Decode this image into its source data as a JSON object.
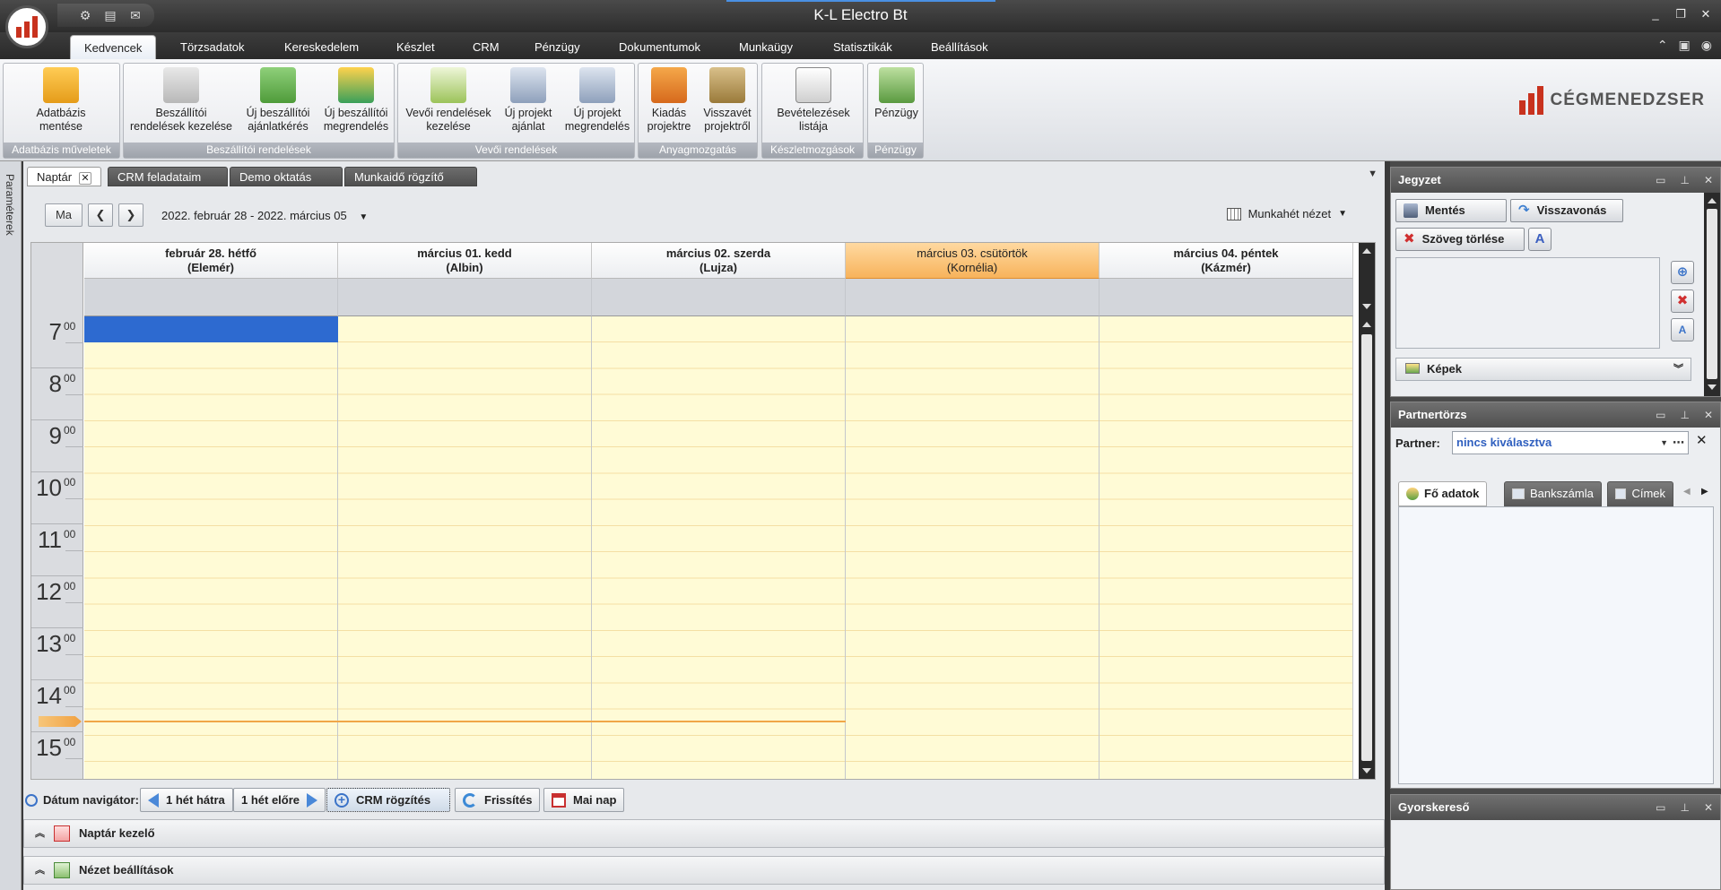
{
  "window": {
    "title": "K-L Electro Bt"
  },
  "quick_tools": [
    {
      "icon": "settings-icon"
    },
    {
      "icon": "clipboard-icon"
    },
    {
      "icon": "mail-icon"
    }
  ],
  "window_controls": [
    "_",
    "❐",
    "✕"
  ],
  "menu": {
    "tabs": [
      "Kedvencek",
      "Törzsadatok",
      "Kereskedelem",
      "Készlet",
      "CRM",
      "Pénzügy",
      "Dokumentumok",
      "Munkaügy",
      "Statisztikák",
      "Beállítások"
    ],
    "active": "Kedvencek",
    "right_icons": [
      "collapse-icon",
      "help-icon",
      "eye-icon"
    ]
  },
  "ribbon": {
    "groups": [
      {
        "label": "Adatbázis műveletek",
        "buttons": [
          {
            "line1": "Adatbázis",
            "line2": "mentése",
            "icon": "database-save-icon"
          }
        ]
      },
      {
        "label": "Beszállítói rendelések",
        "buttons": [
          {
            "line1": "Beszállítói",
            "line2": "rendelések kezelése",
            "icon": "supplier-orders-icon"
          },
          {
            "line1": "Új beszállítói",
            "line2": "ajánlatkérés",
            "icon": "supplier-quote-icon"
          },
          {
            "line1": "Új beszállítói",
            "line2": "megrendelés",
            "icon": "supplier-order-icon"
          }
        ]
      },
      {
        "label": "Vevői rendelések",
        "buttons": [
          {
            "line1": "Vevői rendelések",
            "line2": "kezelése",
            "icon": "customer-orders-icon"
          },
          {
            "line1": "Új projekt",
            "line2": "ajánlat",
            "icon": "project-offer-icon"
          },
          {
            "line1": "Új projekt",
            "line2": "megrendelés",
            "icon": "project-order-icon"
          }
        ]
      },
      {
        "label": "Anyagmozgatás",
        "buttons": [
          {
            "line1": "Kiadás",
            "line2": "projektre",
            "icon": "issue-box-icon"
          },
          {
            "line1": "Visszavét",
            "line2": "projektről",
            "icon": "return-box-icon"
          }
        ]
      },
      {
        "label": "Készletmozgások",
        "buttons": [
          {
            "line1": "Bevételezések",
            "line2": "listája",
            "icon": "receipts-list-icon"
          }
        ]
      },
      {
        "label": "Pénzügy",
        "buttons": [
          {
            "line1": "Pénzügy",
            "line2": "",
            "icon": "money-icon"
          }
        ]
      }
    ],
    "brand": "CÉGMENEDZSER"
  },
  "side_strip": {
    "label": "Paraméterek"
  },
  "doc_tabs": [
    {
      "label": "Naptár",
      "active": true
    },
    {
      "label": "CRM feladataim"
    },
    {
      "label": "Demo oktatás"
    },
    {
      "label": "Munkaidő rögzítő"
    }
  ],
  "calendar": {
    "today_button": "Ma",
    "prev_icon": "chevron-left-icon",
    "next_icon": "chevron-right-icon",
    "date_range": "2022. február 28 - 2022. március 05",
    "view": "Munkahét nézet",
    "days": [
      {
        "date": "február 28. hétfő",
        "name": "(Elemér)",
        "today": false
      },
      {
        "date": "március 01. kedd",
        "name": "(Albin)",
        "today": false
      },
      {
        "date": "március 02. szerda",
        "name": "(Lujza)",
        "today": false
      },
      {
        "date": "március 03. csütörtök",
        "name": "(Kornélia)",
        "today": true
      },
      {
        "date": "március 04. péntek",
        "name": "(Kázmér)",
        "today": false
      }
    ],
    "hours": [
      {
        "h": "7",
        "m": "00"
      },
      {
        "h": "8",
        "m": "00"
      },
      {
        "h": "9",
        "m": "00"
      },
      {
        "h": "10",
        "m": "00"
      },
      {
        "h": "11",
        "m": "00"
      },
      {
        "h": "12",
        "m": "00"
      },
      {
        "h": "13",
        "m": "00"
      },
      {
        "h": "14",
        "m": "00"
      },
      {
        "h": "15",
        "m": "00"
      }
    ],
    "colors": {
      "selection": "#2d6ad0",
      "today_header": "#f7b35b",
      "work_hours": "#fffbd6",
      "now_line": "#f0a648"
    }
  },
  "navigator": {
    "label": "Dátum navigátor:",
    "buttons": [
      "1 hét hátra",
      "1 hét előre",
      "CRM rögzítés",
      "Frissítés",
      "Mai nap"
    ]
  },
  "sections": [
    {
      "label": "Naptár kezelő"
    },
    {
      "label": "Nézet beállítások"
    }
  ],
  "panels": {
    "jegyzet": {
      "title": "Jegyzet",
      "save": "Mentés",
      "undo": "Visszavonás",
      "clear": "Szöveg törlése",
      "images": "Képek"
    },
    "partner": {
      "title": "Partnertörzs",
      "label": "Partner:",
      "value": "nincs kiválasztva",
      "tabs": [
        "Fő adatok",
        "Bankszámla",
        "Címek"
      ]
    },
    "search": {
      "title": "Gyorskereső"
    }
  }
}
